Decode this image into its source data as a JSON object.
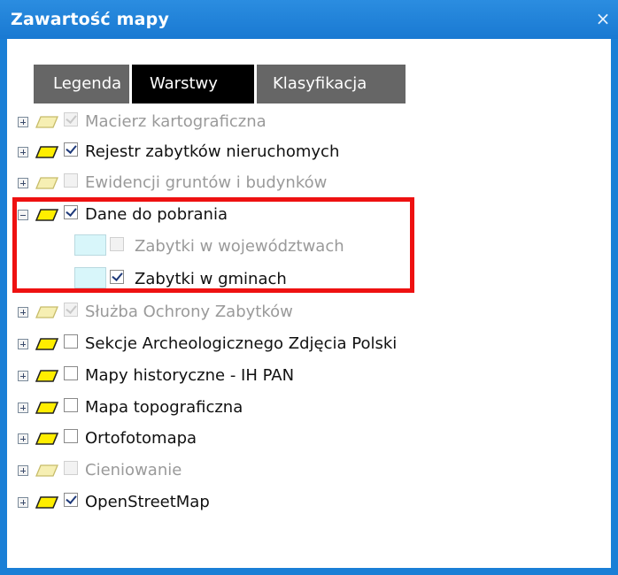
{
  "window": {
    "title": "Zawartość mapy",
    "close_glyph": "×"
  },
  "tabs": [
    {
      "label": "Legenda",
      "active": false
    },
    {
      "label": "Warstwy",
      "active": true
    },
    {
      "label": "Klasyfikacja",
      "active": false
    }
  ],
  "layers": {
    "macierz": {
      "label": "Macierz kartograficzna",
      "checked": true,
      "enabled": false,
      "expanded": false
    },
    "rejestr": {
      "label": "Rejestr zabytków nieruchomych",
      "checked": true,
      "enabled": true,
      "expanded": false
    },
    "ewidencja": {
      "label": "Ewidencji gruntów i budynków",
      "checked": false,
      "enabled": false,
      "expanded": false
    },
    "dane": {
      "label": "Dane do pobrania",
      "checked": true,
      "enabled": true,
      "expanded": true
    },
    "dane_wojewodztwa": {
      "label": "Zabytki w województwach",
      "checked": false,
      "enabled": false
    },
    "dane_gminy": {
      "label": "Zabytki w gminach",
      "checked": true,
      "enabled": true
    },
    "sluzba": {
      "label": "Służba Ochrony Zabytków",
      "checked": true,
      "enabled": false,
      "expanded": false
    },
    "sekcje": {
      "label": "Sekcje Archeologicznego Zdjęcia Polski",
      "checked": false,
      "enabled": true,
      "expanded": false
    },
    "mapy_historyczne": {
      "label": "Mapy historyczne - IH PAN",
      "checked": false,
      "enabled": true,
      "expanded": false
    },
    "topograficzna": {
      "label": "Mapa topograficzna",
      "checked": false,
      "enabled": true,
      "expanded": false
    },
    "ortofotomapa": {
      "label": "Ortofotomapa",
      "checked": false,
      "enabled": true,
      "expanded": false
    },
    "cieniowanie": {
      "label": "Cieniowanie",
      "checked": false,
      "enabled": false,
      "expanded": false
    },
    "osm": {
      "label": "OpenStreetMap",
      "checked": true,
      "enabled": true,
      "expanded": false
    }
  },
  "colors": {
    "titlebar": "#1a7fd6",
    "tab_active": "#000000",
    "tab_inactive": "#666666",
    "highlight_border": "#ee1111",
    "layer_icon_fill": "#ffee00",
    "layer_icon_fill_disabled": "#f3eaa0",
    "sublegend_fill": "#d8f6fa"
  },
  "icons": {
    "layer": "layer-parallelogram-icon",
    "expand": "plus-box-icon",
    "collapse": "minus-box-icon",
    "close": "close-icon"
  }
}
